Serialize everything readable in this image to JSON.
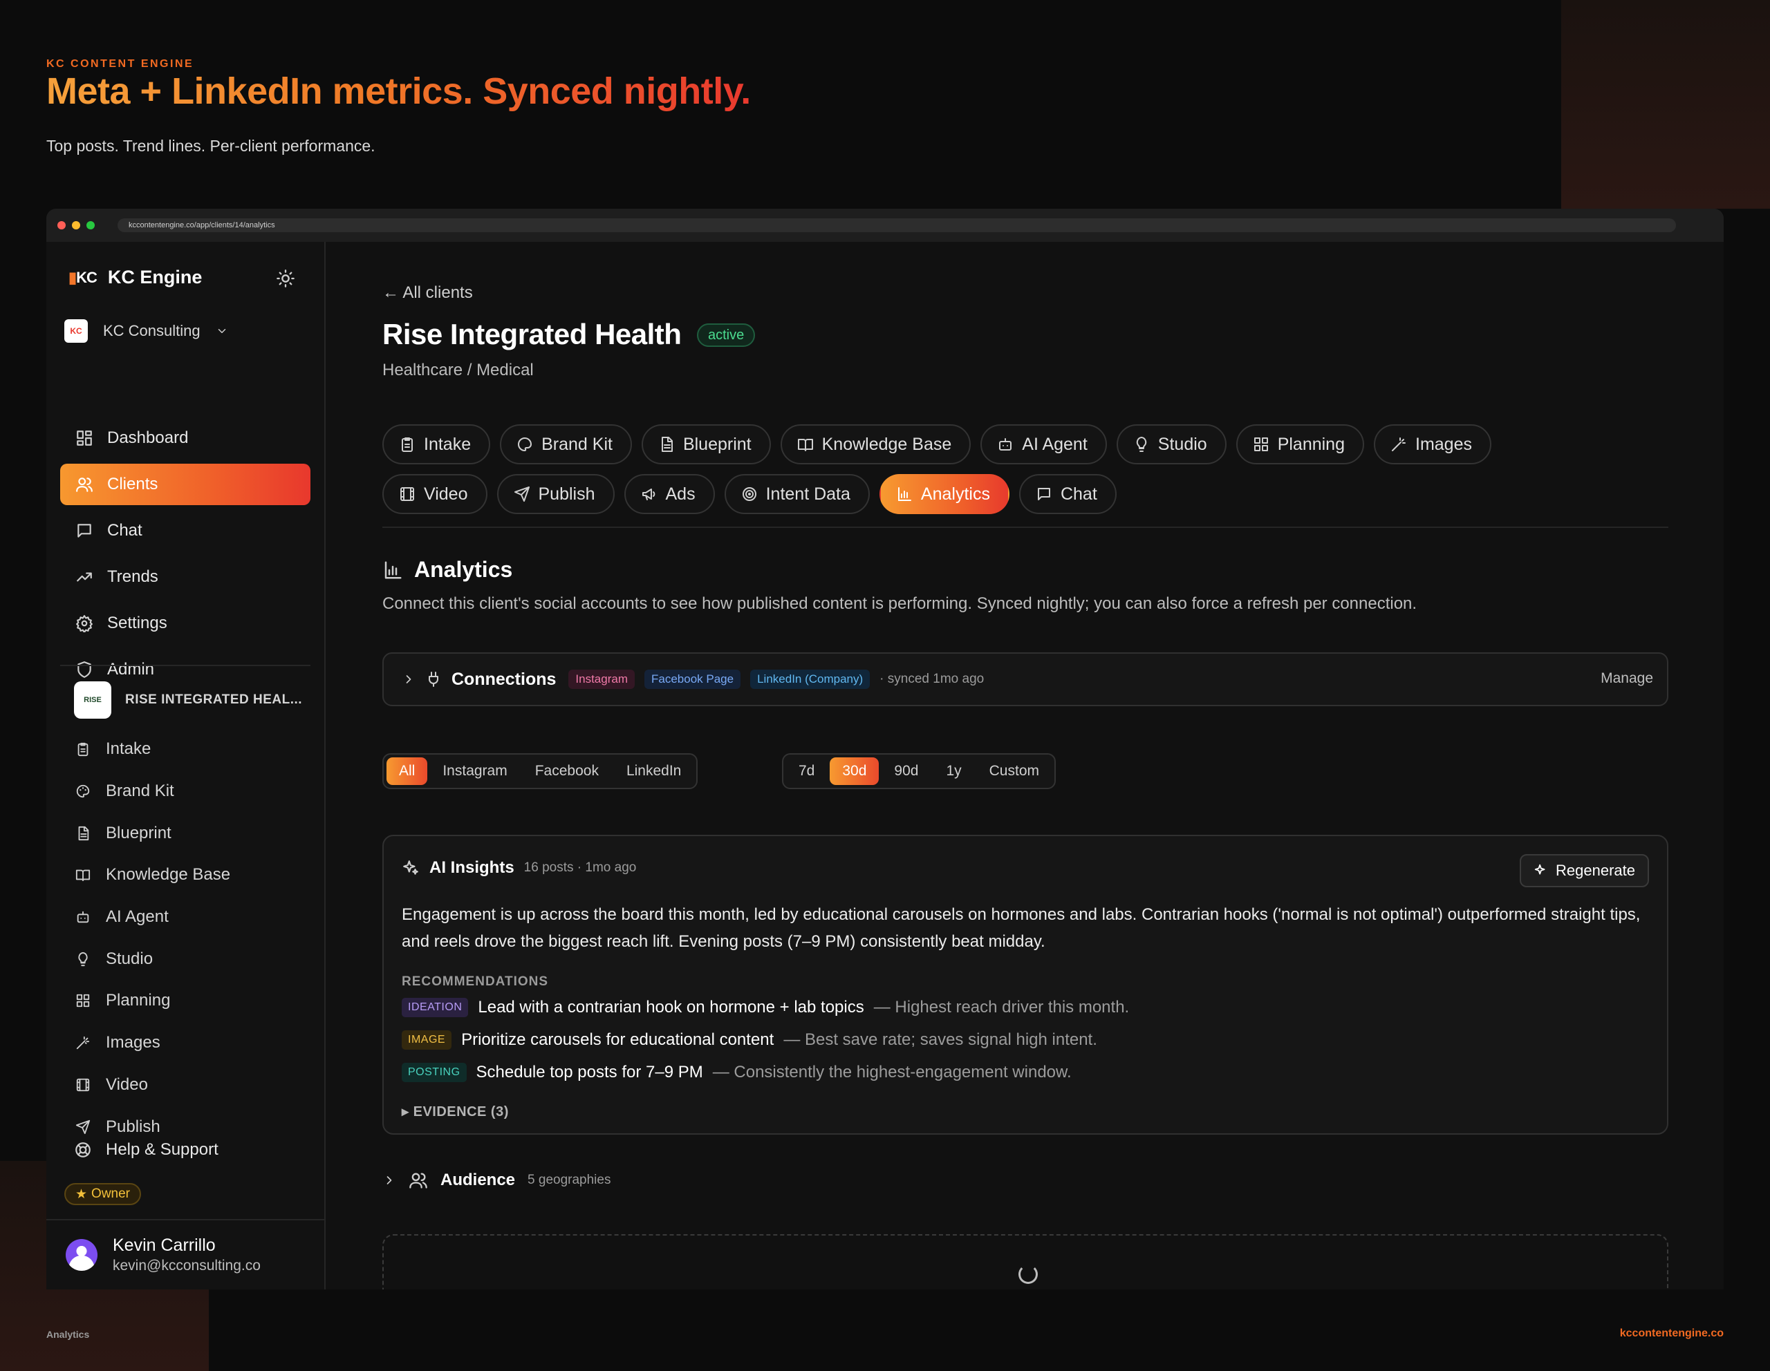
{
  "hero": {
    "kicker": "KC CONTENT ENGINE",
    "title": "Meta + LinkedIn metrics. Synced nightly.",
    "subtitle": "Top posts. Trend lines. Per-client performance."
  },
  "footer": {
    "left": "Analytics",
    "right": "kccontentengine.co"
  },
  "browser": {
    "url": "kccontentengine.co/app/clients/14/analytics"
  },
  "sidebar": {
    "brand_mark": "KC",
    "brand_name": "KC Engine",
    "org_logo": "KC",
    "org_name": "KC Consulting",
    "nav": [
      {
        "label": "Dashboard",
        "icon": "dashboard-icon"
      },
      {
        "label": "Clients",
        "icon": "users-icon"
      },
      {
        "label": "Chat",
        "icon": "chat-icon"
      },
      {
        "label": "Trends",
        "icon": "trend-icon"
      },
      {
        "label": "Settings",
        "icon": "gear-icon"
      },
      {
        "label": "Admin",
        "icon": "shield-icon"
      }
    ],
    "client_logo": "RISE",
    "client_name": "RISE INTEGRATED HEAL...",
    "client_nav": [
      {
        "label": "Intake"
      },
      {
        "label": "Brand Kit"
      },
      {
        "label": "Blueprint"
      },
      {
        "label": "Knowledge Base"
      },
      {
        "label": "AI Agent"
      },
      {
        "label": "Studio"
      },
      {
        "label": "Planning"
      },
      {
        "label": "Images"
      },
      {
        "label": "Video"
      },
      {
        "label": "Publish"
      }
    ],
    "help_label": "Help & Support",
    "owner_badge": "Owner",
    "user": {
      "name": "Kevin Carrillo",
      "email": "kevin@kcconsulting.co"
    }
  },
  "main": {
    "back_link": "All clients",
    "client_title": "Rise Integrated Health",
    "status": "active",
    "industry": "Healthcare / Medical",
    "tabs_row1": [
      {
        "label": "Intake"
      },
      {
        "label": "Brand Kit"
      },
      {
        "label": "Blueprint"
      },
      {
        "label": "Knowledge Base"
      },
      {
        "label": "AI Agent"
      },
      {
        "label": "Studio"
      },
      {
        "label": "Planning"
      },
      {
        "label": "Images"
      }
    ],
    "tabs_row2": [
      {
        "label": "Video"
      },
      {
        "label": "Publish"
      },
      {
        "label": "Ads"
      },
      {
        "label": "Intent Data"
      },
      {
        "label": "Analytics",
        "active": true
      },
      {
        "label": "Chat"
      }
    ],
    "section_title": "Analytics",
    "section_desc": "Connect this client's social accounts to see how published content is performing. Synced nightly; you can also force a refresh per connection.",
    "connections": {
      "title": "Connections",
      "platforms": [
        "Instagram",
        "Facebook Page",
        "LinkedIn (Company)"
      ],
      "sync": "· synced 1mo ago",
      "manage": "Manage"
    },
    "platform_filter": {
      "options": [
        "All",
        "Instagram",
        "Facebook",
        "LinkedIn"
      ],
      "selected": "All"
    },
    "range_filter": {
      "options": [
        "7d",
        "30d",
        "90d",
        "1y",
        "Custom"
      ],
      "selected": "30d"
    },
    "insights": {
      "title": "AI Insights",
      "meta": "16 posts · 1mo ago",
      "regenerate": "Regenerate",
      "summary": "Engagement is up across the board this month, led by educational carousels on hormones and labs. Contrarian hooks ('normal is not optimal') outperformed straight tips, and reels drove the biggest reach lift. Evening posts (7–9 PM) consistently beat midday.",
      "rec_label": "RECOMMENDATIONS",
      "recommendations": [
        {
          "tag": "IDEATION",
          "title": "Lead with a contrarian hook on hormone + lab topics",
          "desc": "— Highest reach driver this month."
        },
        {
          "tag": "IMAGE",
          "title": "Prioritize carousels for educational content",
          "desc": "— Best save rate; saves signal high intent."
        },
        {
          "tag": "POSTING",
          "title": "Schedule top posts for 7–9 PM",
          "desc": "— Consistently the highest-engagement window."
        }
      ],
      "evidence": "EVIDENCE (3)"
    },
    "audience": {
      "title": "Audience",
      "meta": "5 geographies"
    }
  },
  "colors": {
    "accent": "#f26a22",
    "accent_end": "#e9392e",
    "owner": "#f3c03a"
  }
}
